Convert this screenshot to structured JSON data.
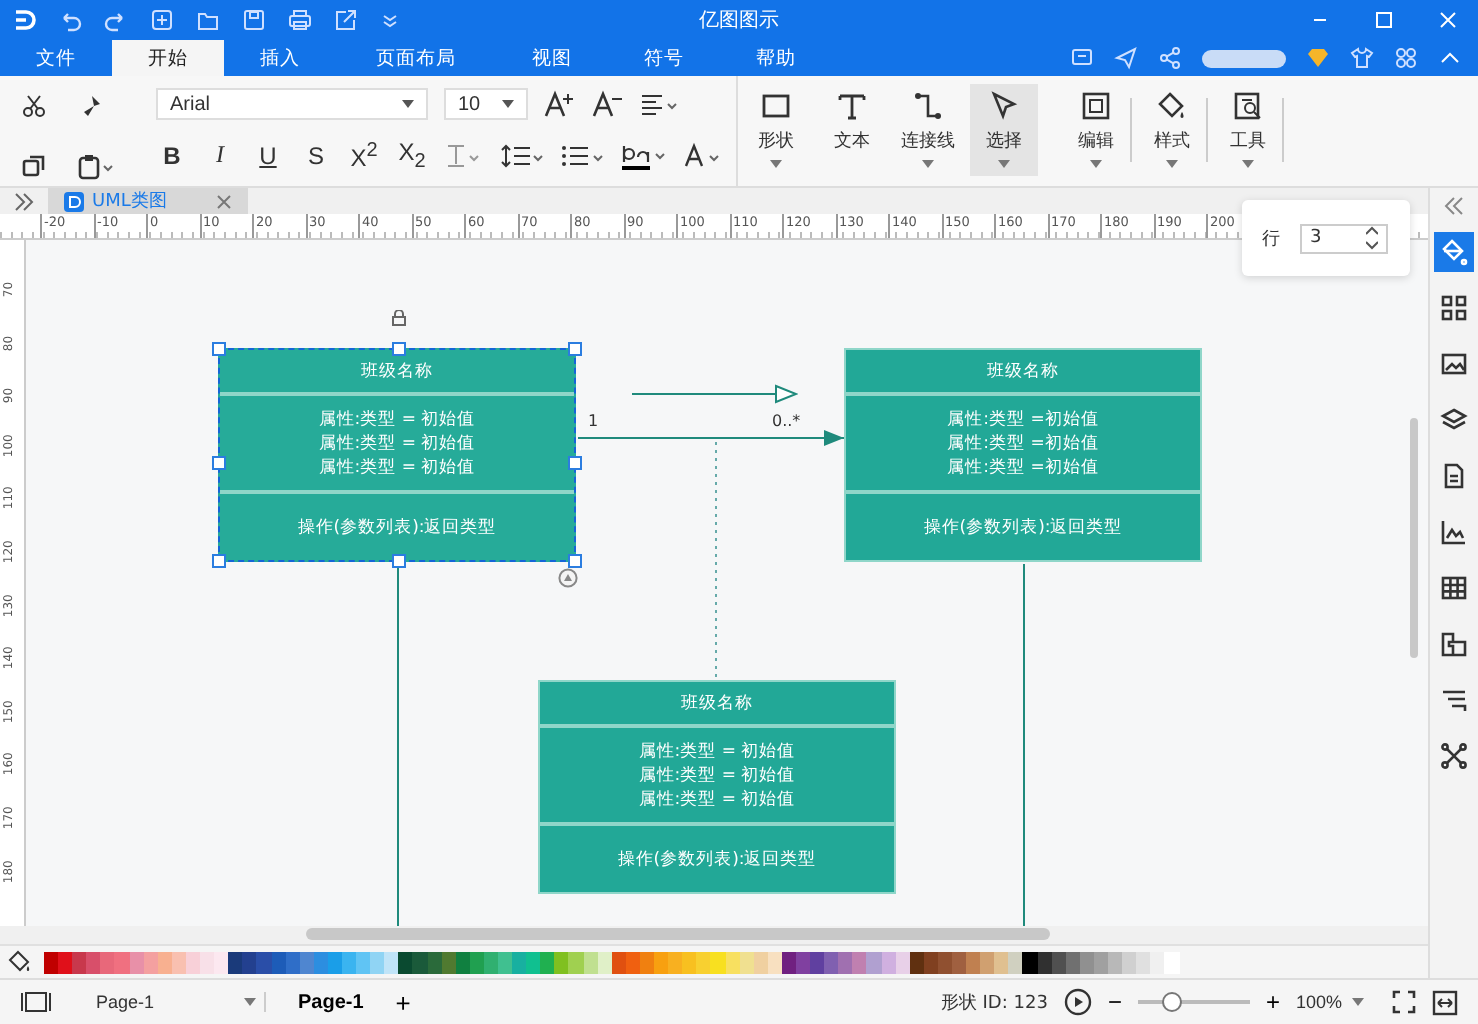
{
  "window": {
    "title": "亿图图示"
  },
  "menu_tabs": [
    {
      "label": "文件",
      "selected": false
    },
    {
      "label": "开始",
      "selected": true
    },
    {
      "label": "插入",
      "selected": false
    },
    {
      "label": "页面布局",
      "selected": false
    },
    {
      "label": "视图",
      "selected": false
    },
    {
      "label": "符号",
      "selected": false
    },
    {
      "label": "帮助",
      "selected": false
    }
  ],
  "toolbar": {
    "font": "Arial",
    "font_size": "10",
    "format_buttons": [
      "B",
      "I",
      "U",
      "S",
      "X$^{2}$",
      "X$_{2}$"
    ],
    "tools": [
      {
        "kind": "rect",
        "label": "形状",
        "selected": false
      },
      {
        "kind": "text",
        "label": "文本",
        "selected": false
      },
      {
        "kind": "connector",
        "label": "连接线",
        "selected": false
      },
      {
        "kind": "pointer",
        "label": "选择",
        "selected": true
      },
      {
        "kind": "edit",
        "label": "编辑",
        "selected": false
      },
      {
        "kind": "fill",
        "label": "样式",
        "selected": false
      },
      {
        "kind": "tools",
        "label": "工具",
        "selected": false
      }
    ]
  },
  "document_tab": {
    "label": "UML类图"
  },
  "ruler": {
    "horizontal": [
      "-20",
      "-10",
      "0",
      "10",
      "20",
      "30",
      "40",
      "50",
      "60",
      "70",
      "80",
      "90",
      "100",
      "110",
      "120",
      "130",
      "140",
      "150",
      "160",
      "170",
      "180",
      "190",
      "200"
    ],
    "vertical": [
      "70",
      "80",
      "90",
      "100",
      "110",
      "120",
      "130",
      "140",
      "150",
      "160",
      "170",
      "180"
    ]
  },
  "row_panel": {
    "label": "行",
    "value": "3"
  },
  "classes": [
    {
      "name": "班级名称",
      "attributes": [
        "属性:类型 = 初始值",
        "属性:类型 = 初始值",
        "属性:类型 = 初始值"
      ],
      "operation": "操作(参数列表):返回类型",
      "selected": true
    },
    {
      "name": "班级名称",
      "attributes": [
        "属性:类型 =初始值",
        "属性:类型 =初始值",
        "属性:类型 =初始值"
      ],
      "operation": "操作(参数列表):返回类型",
      "selected": false
    },
    {
      "name": "班级名称",
      "attributes": [
        "属性:类型 = 初始值",
        "属性:类型 = 初始值",
        "属性:类型 = 初始值"
      ],
      "operation": "操作(参数列表):返回类型",
      "selected": false
    }
  ],
  "association": {
    "source_multiplicity": "1",
    "target_multiplicity": "0..*"
  },
  "right_panel": [
    {
      "kind": "fill",
      "selected": true
    },
    {
      "kind": "grid",
      "selected": false
    },
    {
      "kind": "image",
      "selected": false
    },
    {
      "kind": "layers",
      "selected": false
    },
    {
      "kind": "page",
      "selected": false
    },
    {
      "kind": "chart",
      "selected": false
    },
    {
      "kind": "table",
      "selected": false
    },
    {
      "kind": "puzzle",
      "selected": false
    },
    {
      "kind": "steps",
      "selected": false
    },
    {
      "kind": "network",
      "selected": false
    }
  ],
  "palette": [
    {
      "color": "#c00000"
    },
    {
      "color": "#e0101a"
    },
    {
      "color": "#c8384c"
    },
    {
      "color": "#d84f6a"
    },
    {
      "color": "#e8687a"
    },
    {
      "color": "#f07080"
    },
    {
      "color": "#e890a8"
    },
    {
      "color": "#f4a0a0"
    },
    {
      "color": "#f8b090"
    },
    {
      "color": "#f9c0b0"
    },
    {
      "color": "#f8d0d8"
    },
    {
      "color": "#f8e0e8"
    },
    {
      "color": "#fce8f0"
    },
    {
      "color": "#1a3a7a"
    },
    {
      "color": "#23408f"
    },
    {
      "color": "#2a4ea8"
    },
    {
      "color": "#1d5cb8"
    },
    {
      "color": "#2f6ec8"
    },
    {
      "color": "#4f86d0"
    },
    {
      "color": "#2c8ee0"
    },
    {
      "color": "#1a9ee8"
    },
    {
      "color": "#3ab4f0"
    },
    {
      "color": "#60c4f4"
    },
    {
      "color": "#90d4f4"
    },
    {
      "color": "#c0e4f8"
    },
    {
      "color": "#0a4a30"
    },
    {
      "color": "#1a5a3a"
    },
    {
      "color": "#2a6a3a"
    },
    {
      "color": "#507a30"
    },
    {
      "color": "#108040"
    },
    {
      "color": "#20a050"
    },
    {
      "color": "#30b070"
    },
    {
      "color": "#40c090"
    },
    {
      "color": "#18b0a0"
    },
    {
      "color": "#10c090"
    },
    {
      "color": "#20b050"
    },
    {
      "color": "#80c020"
    },
    {
      "color": "#a0d050"
    },
    {
      "color": "#c0e090"
    },
    {
      "color": "#e0f0c8"
    },
    {
      "color": "#e05010"
    },
    {
      "color": "#f06010"
    },
    {
      "color": "#f08010"
    },
    {
      "color": "#f8a010"
    },
    {
      "color": "#f8b020"
    },
    {
      "color": "#f8c020"
    },
    {
      "color": "#f8d030"
    },
    {
      "color": "#f8e020"
    },
    {
      "color": "#f8e060"
    },
    {
      "color": "#f0e090"
    },
    {
      "color": "#f0d0a0"
    },
    {
      "color": "#f8e0c0"
    },
    {
      "color": "#702080"
    },
    {
      "color": "#8040a0"
    },
    {
      "color": "#6040a0"
    },
    {
      "color": "#8060b0"
    },
    {
      "color": "#a070b0"
    },
    {
      "color": "#c080b0"
    },
    {
      "color": "#b0a0d0"
    },
    {
      "color": "#d0b0e0"
    },
    {
      "color": "#e8d0e8"
    },
    {
      "color": "#603010"
    },
    {
      "color": "#804020"
    },
    {
      "color": "#905030"
    },
    {
      "color": "#a06040"
    },
    {
      "color": "#c08050"
    },
    {
      "color": "#d0a070"
    },
    {
      "color": "#e0c090"
    },
    {
      "color": "#d0d0c0"
    },
    {
      "color": "#000000"
    },
    {
      "color": "#303030"
    },
    {
      "color": "#505050"
    },
    {
      "color": "#707070"
    },
    {
      "color": "#909090"
    },
    {
      "color": "#a0a0a0"
    },
    {
      "color": "#b8b8b8"
    },
    {
      "color": "#d0d0d0"
    },
    {
      "color": "#e0e0e0"
    },
    {
      "color": "#f0f0f0"
    },
    {
      "color": "#ffffff"
    }
  ],
  "status_bar": {
    "page_select": "Page-1",
    "page_tab": "Page-1",
    "add_page": "+",
    "shape_id": "形状 ID: 123",
    "zoom_minus": "−",
    "zoom_plus": "+",
    "zoom_slider": {
      "level": 0.3
    },
    "zoom": "100%"
  }
}
